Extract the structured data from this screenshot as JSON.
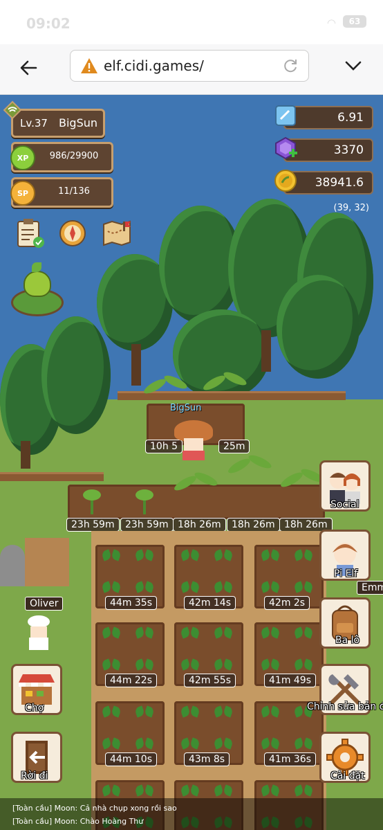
{
  "status_bar": {
    "time": "09:02",
    "battery": "63"
  },
  "browser": {
    "url": "elf.cidi.games/"
  },
  "hud": {
    "level": "Lv.37",
    "player_name": "BigSun",
    "xp_badge": "XP",
    "xp": "986/29900",
    "sp_badge": "SP",
    "sp": "11/136",
    "crystals": "6.91",
    "gems": "3370",
    "coins": "38941.6",
    "coords": "(39, 32)"
  },
  "field": {
    "player_tag": "BigSun",
    "top_timers": [
      "10h 5",
      "25m"
    ],
    "sprout_timers": [
      "23h 59m",
      "23h 59m",
      "18h 26m",
      "18h 26m",
      "18h 26m"
    ],
    "plot_timers": [
      [
        "44m 35s",
        "42m 14s",
        "42m 2s"
      ],
      [
        "44m 22s",
        "42m 55s",
        "41m 49s"
      ],
      [
        "44m 10s",
        "43m 8s",
        "41m 36s"
      ]
    ]
  },
  "npc": {
    "oliver": "Oliver",
    "emm": "Emm"
  },
  "right_menu": [
    {
      "label": "Social"
    },
    {
      "label": "Pi Elf"
    },
    {
      "label": "Ba lô"
    },
    {
      "label": "Chỉnh sửa bản đồ"
    },
    {
      "label": "Cài đặt"
    }
  ],
  "left_menu": [
    {
      "label": "Chợ"
    },
    {
      "label": "Rời đi"
    }
  ],
  "chat": [
    "[Toàn cầu] Moon: Cả nhà chụp xong rồi sao",
    "[Toàn cầu] Moon: Chào Hoàng Thư"
  ]
}
